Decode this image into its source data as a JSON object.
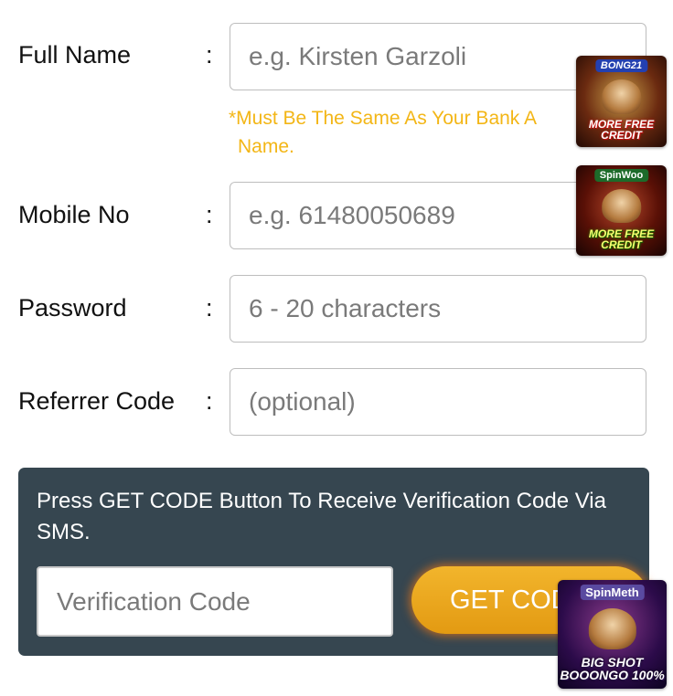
{
  "form": {
    "full_name": {
      "label": "Full Name",
      "colon": ":",
      "placeholder": "e.g. Kirsten Garzoli"
    },
    "full_name_note": {
      "line1": "*Must Be The Same As Your Bank A",
      "line2": "Name."
    },
    "mobile": {
      "label": "Mobile No",
      "colon": ":",
      "placeholder": "e.g. 61480050689"
    },
    "password": {
      "label": "Password",
      "colon": ":",
      "placeholder": "6 - 20 characters"
    },
    "referrer": {
      "label": "Referrer Code",
      "colon": ":",
      "placeholder": "(optional)"
    }
  },
  "verification": {
    "instruction": "Press GET CODE Button To Receive Verification Code Via SMS.",
    "code_placeholder": "Verification Code",
    "get_code_label": "GET CODE"
  },
  "promos": [
    {
      "brand": "BONG21",
      "caption": "MORE FREE CREDIT"
    },
    {
      "brand": "SpinWoo",
      "caption": "MORE FREE CREDIT"
    },
    {
      "brand": "SpinMeth",
      "caption": "BIG SHOT BOOONGO 100%"
    }
  ],
  "colors": {
    "note": "#f3b616",
    "panel_bg": "#364650",
    "button_gradient_top": "#f2b52c",
    "button_gradient_bottom": "#e39a12"
  }
}
